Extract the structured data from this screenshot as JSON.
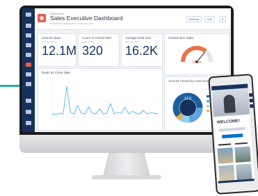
{
  "dashboard": {
    "breadcrumb": "Dashboard",
    "title": "Sales Executive Dashboard",
    "subtitle": "A dashboard showing KPIs for executive users",
    "buttons": {
      "refresh": "Refresh",
      "edit": "Edit"
    }
  },
  "metrics": [
    {
      "title": "Amount Open",
      "sub": "Sum of Amount",
      "value": "12.1M"
    },
    {
      "title": "Count of Closed Won",
      "sub": "Count of Opp",
      "value": "320"
    },
    {
      "title": "Average Deal Size",
      "sub": "Sum of Amount",
      "value": "16.2K"
    }
  ],
  "gauge": {
    "title": "Closed Won Sales",
    "value": "14.5M",
    "fraction": 0.72
  },
  "line_card": {
    "title": "Deals by Close Date"
  },
  "donut_card": {
    "title": "Amount Closed by Lead Source",
    "center_value": "14.0"
  },
  "phone": {
    "welcome": "WELCOME!"
  },
  "colors": {
    "navy": "#16325c",
    "accent": "#e8594a",
    "line": "#4ab5e8",
    "teal": "#22b0a0"
  }
}
